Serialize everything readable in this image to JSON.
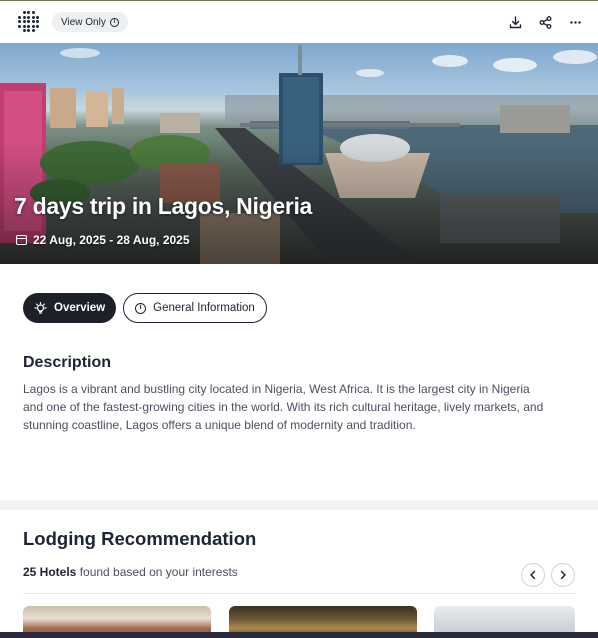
{
  "topbar": {
    "logo_icon": "dot-grid-logo-icon",
    "view_only_label": "View Only",
    "actions": [
      "download-icon",
      "share-icon",
      "more-icon"
    ]
  },
  "hero": {
    "title": "7 days trip in Lagos, Nigeria",
    "dates": "22 Aug, 2025 - 28 Aug, 2025"
  },
  "tabs": [
    {
      "label": "Overview",
      "icon": "lightbulb-icon",
      "active": true
    },
    {
      "label": "General Information",
      "icon": "info-icon",
      "active": false
    }
  ],
  "description": {
    "heading": "Description",
    "text": "Lagos is a vibrant and bustling city located in Nigeria, West Africa. It is the largest city in Nigeria and one of the fastest-growing cities in the world. With its rich cultural heritage, lively markets, and stunning coastline, Lagos offers a unique blend of modernity and tradition."
  },
  "lodging": {
    "heading": "Lodging Recommendation",
    "count_label": "25 Hotels",
    "count_suffix": " found based on your interests"
  },
  "colors": {
    "accent_dark": "#1d2029",
    "text_primary": "#1d2433",
    "text_secondary": "#4a5060"
  }
}
